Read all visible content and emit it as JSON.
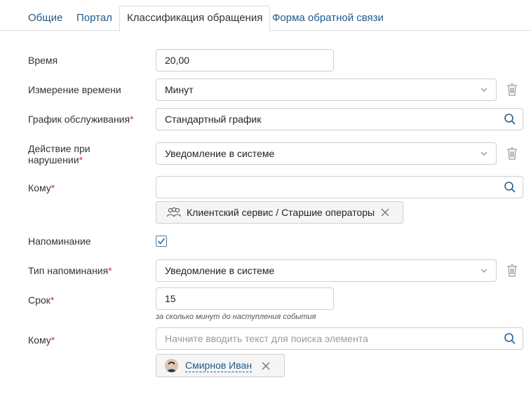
{
  "tabs": [
    {
      "label": "Общие"
    },
    {
      "label": "Портал"
    },
    {
      "label": "Классификация обращения"
    },
    {
      "label": "Форма обратной связи"
    }
  ],
  "form": {
    "time_label": "Время",
    "time_value": "20,00",
    "time_unit_label": "Измерение времени",
    "time_unit_value": "Минут",
    "schedule_label": "График обслуживания",
    "schedule_value": "Стандартный график",
    "violation_action_label_1": "Действие при",
    "violation_action_label_2": "нарушении",
    "violation_action_value": "Уведомление в системе",
    "recipients_label": "Кому",
    "recipients_chip": "Клиентский сервис / Старшие операторы",
    "reminder_label": "Напоминание",
    "reminder_checked": true,
    "reminder_type_label": "Тип напоминания",
    "reminder_type_value": "Уведомление в системе",
    "deadline_label": "Срок",
    "deadline_value": "15",
    "deadline_hint": "за сколько минут до наступления события",
    "recipients2_label": "Кому",
    "recipients2_placeholder": "Начните вводить текст для поиска элемента",
    "recipients2_chip": "Смирнов Иван",
    "required_mark": "*"
  },
  "colors": {
    "link": "#1f5a8c",
    "required": "#d9342b",
    "border": "#cfcfcf"
  }
}
